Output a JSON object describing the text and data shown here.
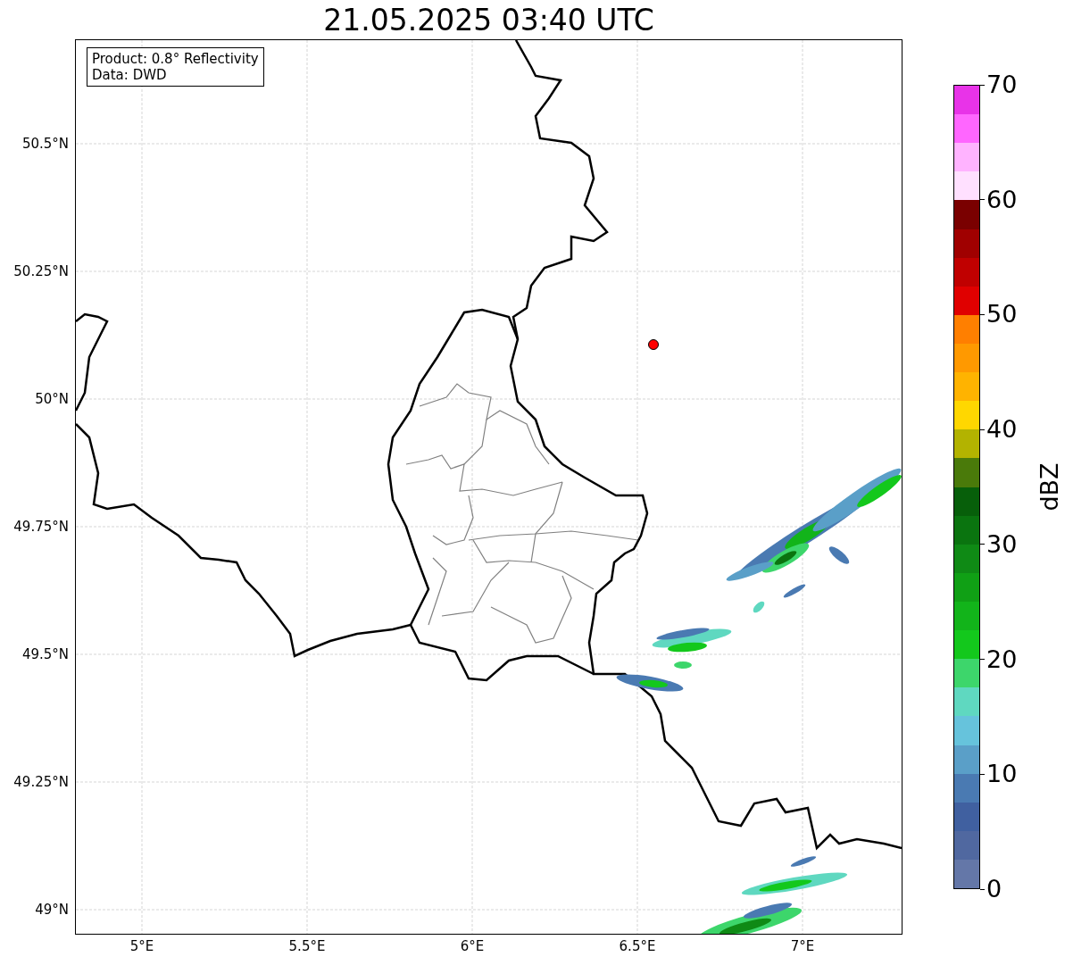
{
  "title": "21.05.2025 03:40 UTC",
  "info_box": {
    "lines": [
      "Product: 0.8° Reflectivity",
      "Data: DWD"
    ]
  },
  "map": {
    "y_ticks": [
      "50.5°N",
      "50.25°N",
      "50°N",
      "49.75°N",
      "49.5°N",
      "49.25°N",
      "49°N"
    ],
    "x_ticks": [
      "5°E",
      "5.5°E",
      "6°E",
      "6.5°E",
      "7°E"
    ]
  },
  "colorbar": {
    "label": "dBZ",
    "ticks": [
      "70",
      "60",
      "50",
      "40",
      "30",
      "20",
      "10",
      "0"
    ],
    "segments": [
      {
        "color": "#e833e8"
      },
      {
        "color": "#ff66ff"
      },
      {
        "color": "#ffb3ff"
      },
      {
        "color": "#ffe0ff"
      },
      {
        "color": "#7a0000"
      },
      {
        "color": "#a00000"
      },
      {
        "color": "#c00000"
      },
      {
        "color": "#e00000"
      },
      {
        "color": "#ff7f00"
      },
      {
        "color": "#ff9900"
      },
      {
        "color": "#ffb300"
      },
      {
        "color": "#ffd700"
      },
      {
        "color": "#b3b300"
      },
      {
        "color": "#4a7a0a"
      },
      {
        "color": "#075f0a"
      },
      {
        "color": "#0a740f"
      },
      {
        "color": "#0f8a15"
      },
      {
        "color": "#10a015"
      },
      {
        "color": "#12b41a"
      },
      {
        "color": "#13c81c"
      },
      {
        "color": "#3dd66b"
      },
      {
        "color": "#5fd8c0"
      },
      {
        "color": "#66c3dc"
      },
      {
        "color": "#5a9fc8"
      },
      {
        "color": "#4a7ab2"
      },
      {
        "color": "#4060a0"
      },
      {
        "color": "#5068a0"
      },
      {
        "color": "#6477a8"
      }
    ]
  }
}
